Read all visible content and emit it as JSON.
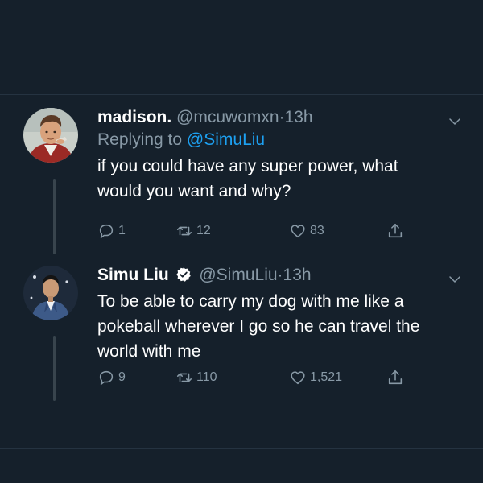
{
  "tweets": [
    {
      "display_name": "madison.",
      "handle": "@mcuwomxn",
      "dot": "·",
      "time": "13h",
      "reply_prefix": "Replying to",
      "reply_mention": "@SimuLiu",
      "text": "if you could have any super power, what\nwould you want and why?",
      "replies": "1",
      "retweets": "12",
      "likes": "83",
      "verified": false,
      "avatar": "animated-character-avatar"
    },
    {
      "display_name": "Simu Liu",
      "handle": "@SimuLiu",
      "dot": "·",
      "time": "13h",
      "text": "To be able to carry my dog with me like a\npokeball wherever I go so he can travel the\nworld with me",
      "replies": "9",
      "retweets": "110",
      "likes": "1,521",
      "verified": true,
      "avatar": "man-in-suit-avatar"
    }
  ],
  "icons": {
    "reply": "speech-bubble-icon",
    "retweet": "retweet-arrows-icon",
    "like": "heart-icon",
    "share": "share-upload-icon",
    "menu": "chevron-down-icon",
    "verified": "verified-badge-icon"
  },
  "colors": {
    "background": "#15202b",
    "text_primary": "#ffffff",
    "text_secondary": "#8899a6",
    "accent": "#1da1f2",
    "thread_line": "#38444d"
  }
}
